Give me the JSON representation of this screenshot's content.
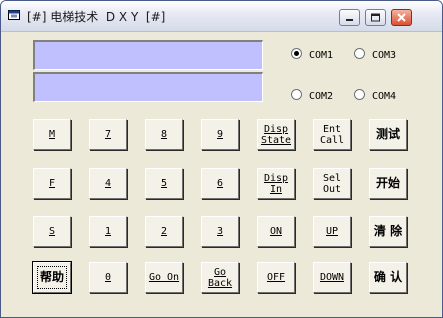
{
  "window": {
    "title": "[#] 电梯技术  D X Y  [#]"
  },
  "ports": [
    {
      "label": "COM1",
      "selected": true
    },
    {
      "label": "COM3",
      "selected": false
    },
    {
      "label": "COM2",
      "selected": false
    },
    {
      "label": "COM4",
      "selected": false
    }
  ],
  "keypad": {
    "rows": [
      [
        "M",
        "7",
        "8",
        "9",
        "Disp\nState",
        "Ent\nCall",
        "测试"
      ],
      [
        "F",
        "4",
        "5",
        "6",
        "Disp\nIn",
        "Sel\nOut",
        "开始"
      ],
      [
        "S",
        "1",
        "2",
        "3",
        "ON",
        "UP",
        "清 除"
      ],
      [
        "帮助",
        "0",
        "Go On",
        "Go\nBack",
        "OFF",
        "DOWN",
        "确 认"
      ]
    ]
  },
  "colors": {
    "display_bg": "#c0c0ff",
    "window_bg": "#ece9d8"
  },
  "icons": [
    "app-icon",
    "minimize-icon",
    "maximize-icon",
    "close-icon"
  ]
}
